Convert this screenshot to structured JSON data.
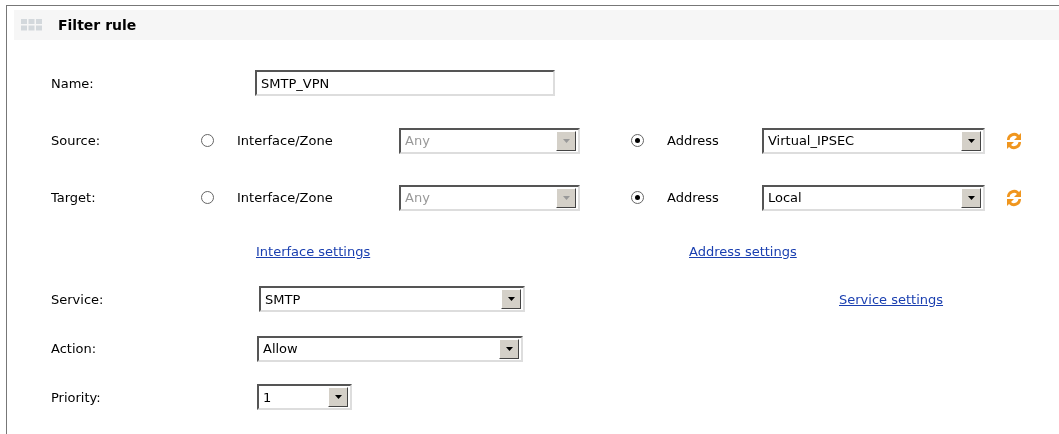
{
  "panel": {
    "title": "Filter rule"
  },
  "name": {
    "label": "Name:",
    "value": "SMTP_VPN"
  },
  "endpoints": [
    {
      "label": "Source:",
      "interface": {
        "label": "Interface/Zone",
        "selected": false,
        "value": "Any",
        "disabled": true
      },
      "address": {
        "label": "Address",
        "selected": true,
        "value": "Virtual_IPSEC",
        "disabled": false
      }
    },
    {
      "label": "Target:",
      "interface": {
        "label": "Interface/Zone",
        "selected": false,
        "value": "Any",
        "disabled": true
      },
      "address": {
        "label": "Address",
        "selected": true,
        "value": "Local",
        "disabled": false
      }
    }
  ],
  "settings_links": [
    "Interface settings",
    "Address settings"
  ],
  "service": {
    "label": "Service:",
    "value": "SMTP",
    "link": "Service settings"
  },
  "action": {
    "label": "Action:",
    "value": "Allow"
  },
  "priority": {
    "label": "Priority:",
    "value": "1"
  }
}
